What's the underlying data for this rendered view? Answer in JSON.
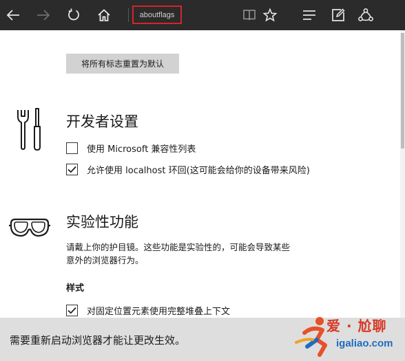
{
  "toolbar": {
    "back_icon": "arrow-left-icon",
    "forward_icon": "arrow-right-icon",
    "refresh_icon": "refresh-icon",
    "home_icon": "home-icon",
    "address_value": "aboutflags",
    "reading_view_icon": "book-icon",
    "favorite_icon": "star-icon",
    "hub_icon": "hub-icon",
    "note_icon": "pen-note-icon",
    "share_icon": "share-icon",
    "highlight_color": "#d6242b"
  },
  "reset_button": {
    "label": "将所有标志重置为默认"
  },
  "developer_section": {
    "title": "开发者设置",
    "icon": "wrench-screwdriver-icon",
    "options": [
      {
        "label": "使用 Microsoft 兼容性列表",
        "checked": false
      },
      {
        "label": "允许使用 localhost 环回(这可能会给你的设备带来风险)",
        "checked": true
      }
    ]
  },
  "experimental_section": {
    "title": "实验性功能",
    "icon": "goggles-icon",
    "description_line1": "请戴上你的护目镜。这些功能是实验性的，可能会导致某些",
    "description_line2": "意外的浏览器行为。",
    "subheading": "样式",
    "options": [
      {
        "label": "对固定位置元素使用完整堆叠上下文",
        "checked": true
      }
    ]
  },
  "notice": {
    "text": "需要重新启动浏览器才能让更改生效。"
  },
  "watermark": {
    "line1": "爱 · 尬聊",
    "line2": "igaliao.com",
    "logo": "running-figure-logo"
  }
}
